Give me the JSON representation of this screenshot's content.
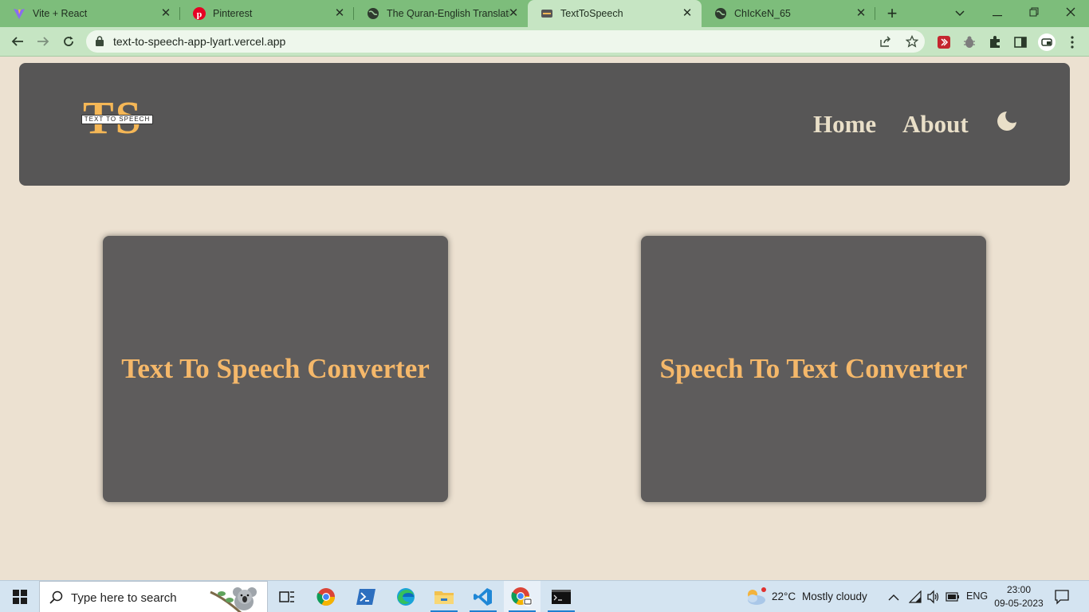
{
  "browser": {
    "tabs": [
      {
        "title": "Vite + React",
        "favicon": "vite-icon"
      },
      {
        "title": "Pinterest",
        "favicon": "pinterest-icon"
      },
      {
        "title": "The Quran-English Translatio",
        "favicon": "globe-icon"
      },
      {
        "title": "TextToSpeech",
        "favicon": "site-icon",
        "active": true
      },
      {
        "title": "ChIcKeN_65",
        "favicon": "globe-icon"
      }
    ],
    "url": "text-to-speech-app-lyart.vercel.app"
  },
  "site": {
    "logo": {
      "letters": "TS",
      "tagline": "TEXT TO SPEECH"
    },
    "nav": {
      "home": "Home",
      "about": "About"
    },
    "theme_toggle_icon": "moon-icon",
    "cards": [
      {
        "label": "Text To Speech Converter"
      },
      {
        "label": "Speech To Text Converter"
      }
    ],
    "colors": {
      "header_bg": "#575656",
      "card_bg": "#5e5c5c",
      "accent": "#f5b86a",
      "page_bg": "#ece1d1",
      "nav_text": "#e9dfc8"
    }
  },
  "taskbar": {
    "search_placeholder": "Type here to search",
    "weather": {
      "temp": "22°C",
      "condition": "Mostly cloudy"
    },
    "language": "ENG",
    "time": "23:00",
    "date": "09-05-2023"
  }
}
